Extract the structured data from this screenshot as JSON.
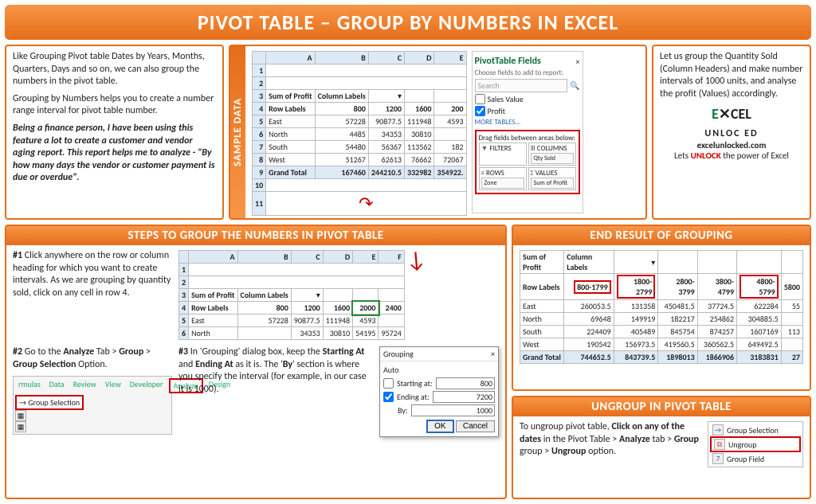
{
  "title": "PIVOT TABLE – GROUP BY NUMBERS IN EXCEL",
  "intro": {
    "p1": "Like Grouping Pivot table Dates by Years, Months, Quarters, Days and so on, we can also group the numbers in the pivot table.",
    "p2": "Grouping by Numbers helps you to create a number range interval for pivot table number.",
    "p3": "Being a finance person, I have been using this feature a lot to create a customer and vendor aging report. This report helps me to analyze - \"By how many days the vendor or customer payment is due or overdue\"."
  },
  "sample": {
    "label": "SAMPLE DATA",
    "cols": [
      "A",
      "B",
      "C",
      "D",
      "E"
    ],
    "header1": "Sum of Profit",
    "header2": "Column Labels",
    "rowlabels": "Row Labels",
    "col_vals": [
      "800",
      "1200",
      "1600",
      "200"
    ],
    "rows": [
      {
        "z": "East",
        "v": [
          "57228",
          "90877.5",
          "111948",
          "4593"
        ]
      },
      {
        "z": "North",
        "v": [
          "4485",
          "34353",
          "30810",
          ""
        ]
      },
      {
        "z": "South",
        "v": [
          "54480",
          "56367",
          "113562",
          "182"
        ]
      },
      {
        "z": "West",
        "v": [
          "51267",
          "62613",
          "76662",
          "72067"
        ]
      },
      {
        "z": "Grand Total",
        "v": [
          "167460",
          "244210.5",
          "332982",
          "354922."
        ]
      }
    ],
    "pf": {
      "title": "PivotTable Fields",
      "choose": "Choose fields to add to report:",
      "search": "Search",
      "f1": "Sales Value",
      "f2": "Profit",
      "more": "MORE TABLES...",
      "drag": "Drag fields between areas below:",
      "filters": "FILTERS",
      "columns": "COLUMNS",
      "rows": "ROWS",
      "values": "VALUES",
      "qty": "Qty Sold",
      "zone": "Zone",
      "sop": "Sum of Profit"
    }
  },
  "topright": {
    "p": "Let us group the Quantity Sold (Column Headers) and make number intervals of 1000 units, and analyse the profit (Values) accordingly.",
    "brand_line1a": "E",
    "brand_line1b": "CEL",
    "brand_line2": "UNLOC ED",
    "site": "excelunlocked.com",
    "tag_pre": "Lets ",
    "tag_mid": "UNLOCK",
    "tag_post": " the power of Excel"
  },
  "steps": {
    "title": "STEPS TO GROUP THE NUMBERS IN PIVOT TABLE",
    "s1_num": "#1",
    "s1": " Click anywhere on the row or column heading for which you want to create intervals. As we are grouping by quantity sold, click on any cell in row 4.",
    "s2_num": "#2",
    "s2a": " Go to the ",
    "s2b": "Analyze",
    "s2c": " Tab > ",
    "s2d": "Group",
    "s2e": " > ",
    "s2f": "Group Selection",
    "s2g": " Option.",
    "s3_num": "#3",
    "s3a": " In 'Grouping' dialog box, keep the ",
    "s3b": "Starting At",
    "s3c": " and ",
    "s3d": "Ending At",
    "s3e": " as it is. The '",
    "s3f": "By",
    "s3g": "' section is where you specify the interval (for example, in our case it is 1000).",
    "ribbon": {
      "tabs": [
        "rmulas",
        "Data",
        "Review",
        "View",
        "Developer",
        "Analyze",
        "Design"
      ],
      "group_sel": "Group Selection"
    },
    "stable": {
      "cols": [
        "A",
        "B",
        "C",
        "D",
        "E",
        "F"
      ],
      "h1": "Sum of Profit",
      "h2": "Column Labels",
      "rl": "Row Labels",
      "cvals": [
        "800",
        "1200",
        "1600",
        "2000",
        "2400"
      ],
      "r1": {
        "z": "East",
        "v": [
          "57228",
          "90877.5",
          "111948",
          "4593",
          ""
        ]
      },
      "r2": {
        "z": "North",
        "v": [
          "",
          "34353",
          "30810",
          "54195",
          "95724"
        ]
      }
    },
    "dialog": {
      "title": "Grouping",
      "auto": "Auto",
      "start": "Starting at:",
      "end": "Ending at:",
      "by": "By:",
      "sv": "800",
      "ev": "7200",
      "bv": "1000",
      "ok": "OK",
      "cancel": "Cancel",
      "close": "×"
    }
  },
  "result": {
    "title": "END RESULT OF GROUPING",
    "h1": "Sum of Profit",
    "h2": "Column Labels",
    "rl": "Row Labels",
    "cvals": [
      "800-1799",
      "1800-2799",
      "2800-3799",
      "3800-4799",
      "4800-5799",
      "5800"
    ],
    "rows": [
      {
        "z": "East",
        "v": [
          "260053.5",
          "131358",
          "450481.5",
          "37724.5",
          "622284",
          "55"
        ]
      },
      {
        "z": "North",
        "v": [
          "69648",
          "149919",
          "182217",
          "254862",
          "304885.5",
          ""
        ]
      },
      {
        "z": "South",
        "v": [
          "224409",
          "405489",
          "845754",
          "874257",
          "1607169",
          "113"
        ]
      },
      {
        "z": "West",
        "v": [
          "190542",
          "156973.5",
          "419560.5",
          "360562.5",
          "649492.5",
          ""
        ]
      },
      {
        "z": "Grand Total",
        "v": [
          "744652.5",
          "843739.5",
          "1898013",
          "1866906",
          "3183831",
          "27"
        ]
      }
    ]
  },
  "ungroup": {
    "title": "UNGROUP IN PIVOT TABLE",
    "p_a": "To ungroup pivot table, ",
    "p_b": "Click on any of the dates",
    "p_c": " in the Pivot Table > ",
    "p_d": "Analyze",
    "p_e": " tab > ",
    "p_f": "Group",
    "p_g": " group > ",
    "p_h": "Ungroup",
    "p_i": " option.",
    "menu": {
      "m1": "Group Selection",
      "m2": "Ungroup",
      "m3": "Group Field"
    }
  },
  "chart_data": null
}
